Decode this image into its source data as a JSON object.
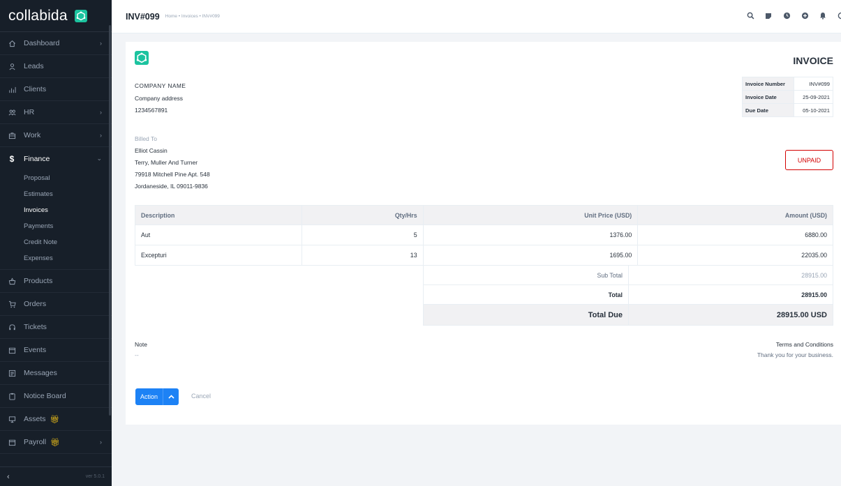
{
  "brand": {
    "name": "collabida",
    "logo_icon": "collabida-logo-icon",
    "accent_color": "#1cc39f"
  },
  "sidebar": {
    "items": [
      {
        "label": "Dashboard",
        "icon": "house-icon",
        "chevron": "›"
      },
      {
        "label": "Leads",
        "icon": "user-icon",
        "chevron": ""
      },
      {
        "label": "Clients",
        "icon": "clients-icon",
        "chevron": ""
      },
      {
        "label": "HR",
        "icon": "people-icon",
        "chevron": "›"
      },
      {
        "label": "Work",
        "icon": "briefcase-icon",
        "chevron": "›"
      },
      {
        "label": "Finance",
        "icon": "dollar-icon",
        "chevron": "⌄"
      }
    ],
    "finance_sub": [
      "Proposal",
      "Estimates",
      "Invoices",
      "Payments",
      "Credit Note",
      "Expenses"
    ],
    "items_after": [
      {
        "label": "Products",
        "icon": "basket-icon",
        "chevron": ""
      },
      {
        "label": "Orders",
        "icon": "cart-icon",
        "chevron": ""
      },
      {
        "label": "Tickets",
        "icon": "headset-icon",
        "chevron": ""
      },
      {
        "label": "Events",
        "icon": "calendar-icon",
        "chevron": ""
      },
      {
        "label": "Messages",
        "icon": "message-icon",
        "chevron": ""
      },
      {
        "label": "Notice Board",
        "icon": "clipboard-icon",
        "chevron": ""
      },
      {
        "label": "Assets",
        "icon": "monitor-icon",
        "chevron": ""
      },
      {
        "label": "Payroll",
        "icon": "payroll-icon",
        "chevron": "›"
      }
    ],
    "footer": {
      "collapse": "‹",
      "version": "ver 5.0.1"
    }
  },
  "topbar": {
    "title": "INV#099",
    "breadcrumb": "Home • Invoices • INV#099",
    "icons": [
      "search-icon",
      "sticky-note-icon",
      "clock-icon",
      "plus-circle-icon",
      "bell-icon"
    ]
  },
  "invoice": {
    "heading": "INVOICE",
    "company": {
      "name": "COMPANY NAME",
      "address": "Company address",
      "phone": "1234567891"
    },
    "meta": [
      {
        "label": "Invoice Number",
        "value": "INV#099"
      },
      {
        "label": "Invoice Date",
        "value": "25-09-2021"
      },
      {
        "label": "Due Date",
        "value": "05-10-2021"
      }
    ],
    "billed_to": {
      "label": "Billed To",
      "name": "Elliot Cassin",
      "company": "Terry, Muller And Turner",
      "street": "79918 Mitchell Pine Apt. 548",
      "city": "Jordaneside, IL 09011-9836"
    },
    "status": "UNPAID",
    "status_color": "#d30000",
    "columns": [
      "Description",
      "Qty/Hrs",
      "Unit Price (USD)",
      "Amount (USD)"
    ],
    "rows": [
      {
        "description": "Aut",
        "qty": "5",
        "unit_price": "1376.00",
        "amount": "6880.00"
      },
      {
        "description": "Excepturi",
        "qty": "13",
        "unit_price": "1695.00",
        "amount": "22035.00"
      }
    ],
    "totals": {
      "sub_total_label": "Sub Total",
      "sub_total": "28915.00",
      "total_label": "Total",
      "total": "28915.00",
      "total_due_label": "Total Due",
      "total_due": "28915.00 USD"
    },
    "note": {
      "label": "Note",
      "value": "--"
    },
    "terms": {
      "label": "Terms and Conditions",
      "value": "Thank you for your business."
    },
    "actions": {
      "action_label": "Action",
      "cancel_label": "Cancel"
    },
    "primary_color": "#1d82f5"
  }
}
